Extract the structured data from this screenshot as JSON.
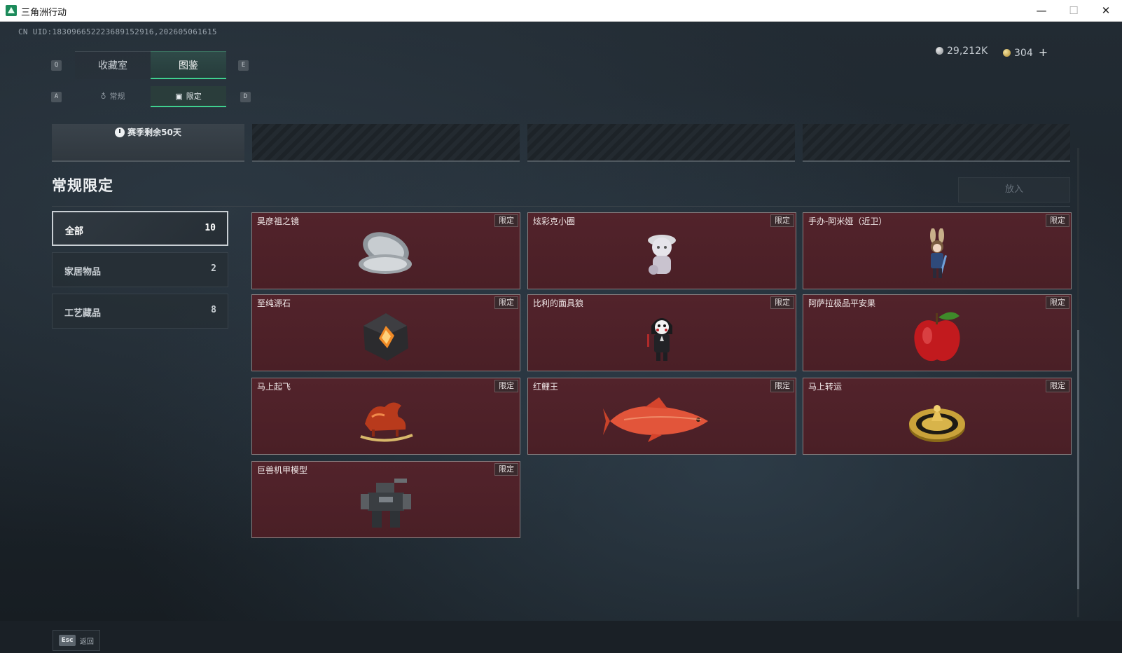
{
  "window": {
    "title": "三角洲行动",
    "minimize": "—",
    "maximize": "☐",
    "close": "✕"
  },
  "header": {
    "uid": "CN UID:18309665222368915291​6,202605061615",
    "currency_silver": "29,212K",
    "currency_gold": "304",
    "currency_add": "+"
  },
  "main_tabs": {
    "key_left": "Q",
    "key_right": "E",
    "items": [
      {
        "label": "收藏室",
        "active": false
      },
      {
        "label": "图鉴",
        "active": true
      }
    ]
  },
  "sub_tabs": {
    "key_left": "A",
    "key_right": "D",
    "items": [
      {
        "label": "常规",
        "icon": "bell-icon",
        "active": false
      },
      {
        "label": "限定",
        "icon": "image-icon",
        "active": true
      }
    ]
  },
  "season_banner": {
    "text": "赛季剩余50天"
  },
  "section": {
    "title": "常规限定",
    "place_button": "放入"
  },
  "categories": [
    {
      "label": "全部",
      "count": "10",
      "active": true
    },
    {
      "label": "家居物品",
      "count": "2",
      "active": false
    },
    {
      "label": "工艺藏品",
      "count": "8",
      "active": false
    }
  ],
  "items": [
    {
      "name": "昊彦祖之镜",
      "badge": "限定",
      "icon": "mirror-icon"
    },
    {
      "name": "炫彩克小圈",
      "badge": "限定",
      "icon": "figurine-icon"
    },
    {
      "name": "手办-阿米娅（近卫）",
      "badge": "限定",
      "icon": "bunny-figure-icon"
    },
    {
      "name": "至纯源石",
      "badge": "限定",
      "icon": "crystal-icon"
    },
    {
      "name": "比利的面具狼",
      "badge": "限定",
      "icon": "puppet-icon"
    },
    {
      "name": "阿萨拉极品平安果",
      "badge": "限定",
      "icon": "apple-icon"
    },
    {
      "name": "马上起飞",
      "badge": "限定",
      "icon": "horse-icon"
    },
    {
      "name": "红鲤王",
      "badge": "限定",
      "icon": "carp-icon"
    },
    {
      "name": "马上转运",
      "badge": "限定",
      "icon": "coin-disc-icon"
    },
    {
      "name": "巨兽机甲模型",
      "badge": "限定",
      "icon": "mech-icon"
    }
  ],
  "footer": {
    "esc_key": "Esc",
    "esc_label": "返回"
  }
}
